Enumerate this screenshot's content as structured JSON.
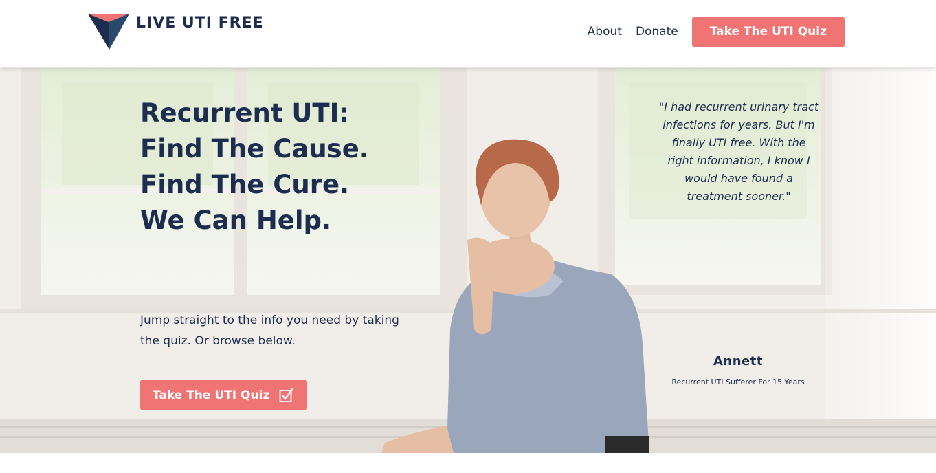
{
  "header": {
    "brand": "LIVE UTI FREE",
    "nav": {
      "about": "About",
      "donate": "Donate"
    },
    "cta_label": "Take The UTI Quiz"
  },
  "hero": {
    "headline": [
      "Recurrent UTI:",
      "Find The Cause.",
      "Find The Cure.",
      "We Can Help."
    ],
    "intro": "Jump straight to the info you need by taking the quiz. Or browse below.",
    "cta_label": "Take The UTI Quiz",
    "cta_icon": "checkbox-icon",
    "background_image": "woman-sitting-by-window-photo"
  },
  "testimonial": {
    "quote": "\"I had recurrent urinary tract infections for years. But I'm finally UTI free. With the right information, I know I would have found a treatment sooner.\"",
    "author": "Annett",
    "author_subtitle": "Recurrent UTI Sufferer For 15 Years"
  },
  "colors": {
    "navy": "#1d2d4f",
    "coral": "#f07474",
    "white": "#ffffff"
  }
}
